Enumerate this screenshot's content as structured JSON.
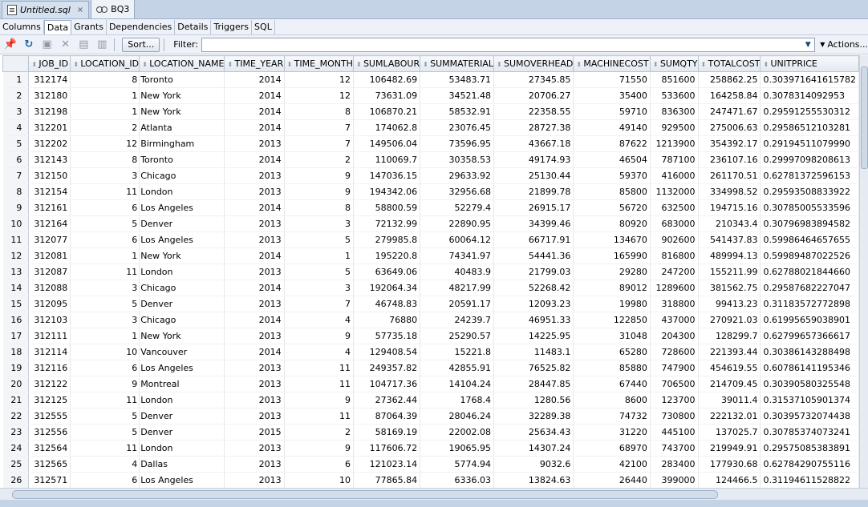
{
  "doc_tabs": [
    {
      "label": "Untitled.sql",
      "close": "×"
    },
    {
      "label": "BQ3",
      "close": ""
    }
  ],
  "sub_tabs": [
    "Columns",
    "Data",
    "Grants",
    "Dependencies",
    "Details",
    "Triggers",
    "SQL"
  ],
  "toolbar": {
    "sort_label": "Sort...",
    "filter_label": "Filter:",
    "filter_value": "",
    "actions_label": "Actions..."
  },
  "columns": [
    "JOB_ID",
    "LOCATION_ID",
    "LOCATION_NAME",
    "TIME_YEAR",
    "TIME_MONTH",
    "SUMLABOUR",
    "SUMMATERIAL",
    "SUMOVERHEAD",
    "MACHINECOST",
    "SUMQTY",
    "TOTALCOST",
    "UNITPRICE"
  ],
  "rows": [
    [
      "1",
      "312174",
      "8",
      "Toronto",
      "2014",
      "12",
      "106482.69",
      "53483.71",
      "27345.85",
      "71550",
      "851600",
      "258862.25",
      "0.303971641615782"
    ],
    [
      "2",
      "312180",
      "1",
      "New York",
      "2014",
      "12",
      "73631.09",
      "34521.48",
      "20706.27",
      "35400",
      "533600",
      "164258.84",
      "0.3078314092953"
    ],
    [
      "3",
      "312198",
      "1",
      "New York",
      "2014",
      "8",
      "106870.21",
      "58532.91",
      "22358.55",
      "59710",
      "836300",
      "247471.67",
      "0.29591255530312"
    ],
    [
      "4",
      "312201",
      "2",
      "Atlanta",
      "2014",
      "7",
      "174062.8",
      "23076.45",
      "28727.38",
      "49140",
      "929500",
      "275006.63",
      "0.29586512103281"
    ],
    [
      "5",
      "312202",
      "12",
      "Birmingham",
      "2013",
      "7",
      "149506.04",
      "73596.95",
      "43667.18",
      "87622",
      "1213900",
      "354392.17",
      "0.29194511079990"
    ],
    [
      "6",
      "312143",
      "8",
      "Toronto",
      "2014",
      "2",
      "110069.7",
      "30358.53",
      "49174.93",
      "46504",
      "787100",
      "236107.16",
      "0.29997098208613"
    ],
    [
      "7",
      "312150",
      "3",
      "Chicago",
      "2013",
      "9",
      "147036.15",
      "29633.92",
      "25130.44",
      "59370",
      "416000",
      "261170.51",
      "0.62781372596153"
    ],
    [
      "8",
      "312154",
      "11",
      "London",
      "2013",
      "9",
      "194342.06",
      "32956.68",
      "21899.78",
      "85800",
      "1132000",
      "334998.52",
      "0.29593508833922"
    ],
    [
      "9",
      "312161",
      "6",
      "Los Angeles",
      "2014",
      "8",
      "58800.59",
      "52279.4",
      "26915.17",
      "56720",
      "632500",
      "194715.16",
      "0.30785005533596"
    ],
    [
      "10",
      "312164",
      "5",
      "Denver",
      "2013",
      "3",
      "72132.99",
      "22890.95",
      "34399.46",
      "80920",
      "683000",
      "210343.4",
      "0.30796983894582"
    ],
    [
      "11",
      "312077",
      "6",
      "Los Angeles",
      "2013",
      "5",
      "279985.8",
      "60064.12",
      "66717.91",
      "134670",
      "902600",
      "541437.83",
      "0.59986464657655"
    ],
    [
      "12",
      "312081",
      "1",
      "New York",
      "2014",
      "1",
      "195220.8",
      "74341.97",
      "54441.36",
      "165990",
      "816800",
      "489994.13",
      "0.59989487022526"
    ],
    [
      "13",
      "312087",
      "11",
      "London",
      "2013",
      "5",
      "63649.06",
      "40483.9",
      "21799.03",
      "29280",
      "247200",
      "155211.99",
      "0.62788021844660"
    ],
    [
      "14",
      "312088",
      "3",
      "Chicago",
      "2014",
      "3",
      "192064.34",
      "48217.99",
      "52268.42",
      "89012",
      "1289600",
      "381562.75",
      "0.29587682227047"
    ],
    [
      "15",
      "312095",
      "5",
      "Denver",
      "2013",
      "7",
      "46748.83",
      "20591.17",
      "12093.23",
      "19980",
      "318800",
      "99413.23",
      "0.31183572772898"
    ],
    [
      "16",
      "312103",
      "3",
      "Chicago",
      "2014",
      "4",
      "76880",
      "24239.7",
      "46951.33",
      "122850",
      "437000",
      "270921.03",
      "0.61995659038901"
    ],
    [
      "17",
      "312111",
      "1",
      "New York",
      "2013",
      "9",
      "57735.18",
      "25290.57",
      "14225.95",
      "31048",
      "204300",
      "128299.7",
      "0.62799657366617"
    ],
    [
      "18",
      "312114",
      "10",
      "Vancouver",
      "2014",
      "4",
      "129408.54",
      "15221.8",
      "11483.1",
      "65280",
      "728600",
      "221393.44",
      "0.30386143288498"
    ],
    [
      "19",
      "312116",
      "6",
      "Los Angeles",
      "2013",
      "11",
      "249357.82",
      "42855.91",
      "76525.82",
      "85880",
      "747900",
      "454619.55",
      "0.60786141195346"
    ],
    [
      "20",
      "312122",
      "9",
      "Montreal",
      "2013",
      "11",
      "104717.36",
      "14104.24",
      "28447.85",
      "67440",
      "706500",
      "214709.45",
      "0.30390580325548"
    ],
    [
      "21",
      "312125",
      "11",
      "London",
      "2013",
      "9",
      "27362.44",
      "1768.4",
      "1280.56",
      "8600",
      "123700",
      "39011.4",
      "0.31537105901374"
    ],
    [
      "22",
      "312555",
      "5",
      "Denver",
      "2013",
      "11",
      "87064.39",
      "28046.24",
      "32289.38",
      "74732",
      "730800",
      "222132.01",
      "0.30395732074438"
    ],
    [
      "23",
      "312556",
      "5",
      "Denver",
      "2015",
      "2",
      "58169.19",
      "22002.08",
      "25634.43",
      "31220",
      "445100",
      "137025.7",
      "0.30785374073241"
    ],
    [
      "24",
      "312564",
      "11",
      "London",
      "2013",
      "9",
      "117606.72",
      "19065.95",
      "14307.24",
      "68970",
      "743700",
      "219949.91",
      "0.29575085383891"
    ],
    [
      "25",
      "312565",
      "4",
      "Dallas",
      "2013",
      "6",
      "121023.14",
      "5774.94",
      "9032.6",
      "42100",
      "283400",
      "177930.68",
      "0.62784290755116"
    ],
    [
      "26",
      "312571",
      "6",
      "Los Angeles",
      "2013",
      "10",
      "77865.84",
      "6336.03",
      "13824.63",
      "26440",
      "399000",
      "124466.5",
      "0.31194611528822"
    ]
  ]
}
